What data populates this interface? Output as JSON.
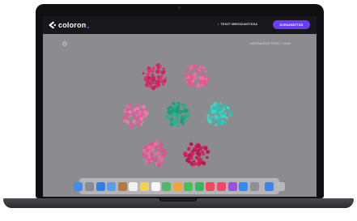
{
  "app": {
    "brand": "coloron",
    "back_link": "TESZT MEGSZAKÍTÁSA",
    "primary_button": "ÚJRAINDÍTÁS",
    "remaining": "HÁTRALÉVŐ TESZT: 10/48"
  },
  "colors": {
    "screen_bg": "#8c8c8e",
    "header_bg": "#18181c",
    "accent": "#6a3df2",
    "pink_a": "#e0317a",
    "pink_b": "#ef6aa6",
    "teal_a": "#2fb39b",
    "teal_b": "#42d3c6",
    "magenta": "#d81b5f"
  },
  "plates": [
    {
      "name": "plate-top-left",
      "color": "#e0317a",
      "alt": "#c9245f"
    },
    {
      "name": "plate-top-right",
      "color": "#f06fa6",
      "alt": "#e4568f"
    },
    {
      "name": "plate-mid-left",
      "color": "#f07ab0",
      "alt": "#e25a98"
    },
    {
      "name": "plate-center",
      "color": "#27b28f",
      "alt": "#1e9a7b"
    },
    {
      "name": "plate-mid-right",
      "color": "#43d6c8",
      "alt": "#2fbfb2"
    },
    {
      "name": "plate-bottom-left",
      "color": "#f06aa4",
      "alt": "#e14e8e"
    },
    {
      "name": "plate-bottom-right",
      "color": "#d81b5f",
      "alt": "#b81650"
    }
  ],
  "dock_icons": [
    {
      "name": "finder-icon",
      "color": "#3d8ef0"
    },
    {
      "name": "launchpad-icon",
      "color": "#8a8a92"
    },
    {
      "name": "safari-icon",
      "color": "#2f7fe6"
    },
    {
      "name": "mail-icon",
      "color": "#5a9ee8"
    },
    {
      "name": "contacts-icon",
      "color": "#b07a45"
    },
    {
      "name": "calendar-icon",
      "color": "#f2f2f2"
    },
    {
      "name": "notes-icon",
      "color": "#f4d24c"
    },
    {
      "name": "reminders-icon",
      "color": "#f7f7f7"
    },
    {
      "name": "maps-icon",
      "color": "#53b46a"
    },
    {
      "name": "photos-icon",
      "color": "#f0a23d"
    },
    {
      "name": "messages-icon",
      "color": "#3fc35a"
    },
    {
      "name": "facetime-icon",
      "color": "#35b85a"
    },
    {
      "name": "news-icon",
      "color": "#ef4a5a"
    },
    {
      "name": "music-icon",
      "color": "#f2466c"
    },
    {
      "name": "podcasts-icon",
      "color": "#9c52d8"
    },
    {
      "name": "appstore-icon",
      "color": "#2f8cf2"
    },
    {
      "name": "settings-icon",
      "color": "#8e8e94"
    },
    {
      "name": "downloads-icon",
      "color": "#3a86e8"
    },
    {
      "name": "trash-icon",
      "color": "#b8b8be"
    }
  ]
}
